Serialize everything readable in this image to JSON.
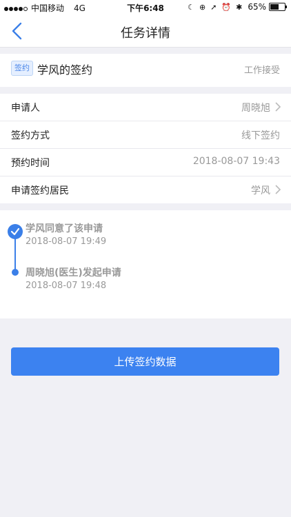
{
  "status_bar": {
    "carrier": "中国移动",
    "network": "4G",
    "time": "下午6:48",
    "battery_percent": "65%",
    "battery_level": 0.65,
    "icons": [
      "moon-icon",
      "orientation-lock-icon",
      "location-icon",
      "alarm-icon",
      "bluetooth-icon"
    ]
  },
  "navbar": {
    "title": "任务详情"
  },
  "task": {
    "tag": "签约",
    "title": "学风的签约",
    "status": "工作接受"
  },
  "info_rows": [
    {
      "label": "申请人",
      "value": "周晓旭",
      "has_arrow": true
    },
    {
      "label": "签约方式",
      "value": "线下签约",
      "has_arrow": false
    },
    {
      "label": "预约时间",
      "value": "2018-08-07 19:43",
      "has_arrow": false
    },
    {
      "label": "申请签约居民",
      "value": "学风",
      "has_arrow": true
    }
  ],
  "timeline": [
    {
      "title": "学风同意了该申请",
      "time": "2018-08-07 19:49"
    },
    {
      "title": "周晓旭(医生)发起申请",
      "time": "2018-08-07 19:48"
    }
  ],
  "colors": {
    "accent": "#3c82f0",
    "background": "#f0f0f5",
    "muted": "#999999"
  },
  "upload_button": {
    "label": "上传签约数据"
  }
}
